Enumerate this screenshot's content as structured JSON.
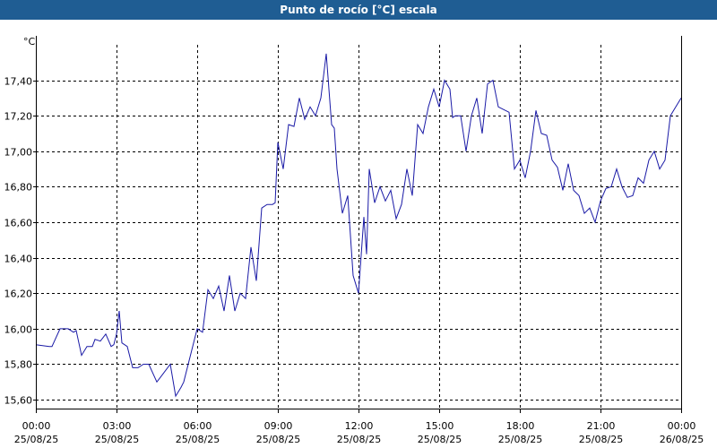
{
  "window": {
    "title": "Punto de rocío [°C] escala"
  },
  "colors": {
    "title_bar": "#1f5d93",
    "line": "#1a1aa6",
    "grid": "#000000"
  },
  "chart_data": {
    "type": "line",
    "title": "Punto de rocío [°C] escala",
    "ylabel": "°C",
    "xlabel": "",
    "ylim": [
      15.55,
      17.6
    ],
    "grid": true,
    "x_unit": "hours",
    "xlim": [
      0,
      24
    ],
    "y_ticks": [
      15.6,
      15.8,
      16.0,
      16.2,
      16.4,
      16.6,
      16.8,
      17.0,
      17.2,
      17.4
    ],
    "y_tick_labels": [
      "15,60",
      "15,80",
      "16,00",
      "16,20",
      "16,40",
      "16,60",
      "16,80",
      "17,00",
      "17,20",
      "17,40"
    ],
    "x_ticks": [
      {
        "t": 0,
        "time": "00:00",
        "date": "25/08/25"
      },
      {
        "t": 3,
        "time": "03:00",
        "date": "25/08/25"
      },
      {
        "t": 6,
        "time": "06:00",
        "date": "25/08/25"
      },
      {
        "t": 9,
        "time": "09:00",
        "date": "25/08/25"
      },
      {
        "t": 12,
        "time": "12:00",
        "date": "25/08/25"
      },
      {
        "t": 15,
        "time": "15:00",
        "date": "25/08/25"
      },
      {
        "t": 18,
        "time": "18:00",
        "date": "25/08/25"
      },
      {
        "t": 21,
        "time": "21:00",
        "date": "25/08/25"
      },
      {
        "t": 24,
        "time": "00:00",
        "date": "26/08/25"
      }
    ],
    "x": [
      0,
      0.5,
      0.6,
      0.9,
      1.2,
      1.4,
      1.5,
      1.7,
      1.9,
      2.1,
      2.2,
      2.4,
      2.6,
      2.8,
      2.9,
      3.0,
      3.1,
      3.2,
      3.4,
      3.6,
      3.8,
      4.0,
      4.2,
      4.5,
      4.7,
      5.0,
      5.2,
      5.4,
      5.5,
      5.8,
      6.0,
      6.2,
      6.4,
      6.6,
      6.8,
      7.0,
      7.2,
      7.4,
      7.6,
      7.8,
      8.0,
      8.2,
      8.4,
      8.6,
      8.8,
      8.9,
      9.0,
      9.2,
      9.4,
      9.6,
      9.8,
      10.0,
      10.2,
      10.4,
      10.6,
      10.8,
      11.0,
      11.1,
      11.2,
      11.4,
      11.6,
      11.8,
      12.0,
      12.2,
      12.3,
      12.4,
      12.6,
      12.8,
      13.0,
      13.2,
      13.4,
      13.6,
      13.8,
      14.0,
      14.2,
      14.4,
      14.6,
      14.8,
      15.0,
      15.2,
      15.4,
      15.5,
      15.6,
      15.8,
      16.0,
      16.2,
      16.4,
      16.6,
      16.8,
      17.0,
      17.2,
      17.6,
      17.8,
      18.0,
      18.2,
      18.4,
      18.6,
      18.8,
      19.0,
      19.2,
      19.4,
      19.6,
      19.8,
      20.0,
      20.2,
      20.4,
      20.6,
      20.8,
      21.0,
      21.2,
      21.4,
      21.6,
      21.8,
      22.0,
      22.2,
      22.4,
      22.6,
      22.8,
      23.0,
      23.2,
      23.4,
      23.6,
      23.8,
      24.0
    ],
    "series": [
      {
        "values": [
          15.91,
          15.9,
          15.9,
          16.0,
          16.0,
          15.98,
          15.99,
          15.85,
          15.9,
          15.9,
          15.94,
          15.93,
          15.97,
          15.9,
          15.91,
          15.97,
          16.1,
          15.92,
          15.9,
          15.78,
          15.78,
          15.8,
          15.8,
          15.7,
          15.74,
          15.8,
          15.62,
          15.67,
          15.7,
          15.88,
          16.0,
          15.98,
          16.22,
          16.17,
          16.24,
          16.1,
          16.3,
          16.1,
          16.2,
          16.17,
          16.46,
          16.27,
          16.68,
          16.7,
          16.7,
          16.71,
          17.05,
          16.9,
          17.15,
          17.14,
          17.3,
          17.18,
          17.25,
          17.2,
          17.3,
          17.55,
          17.15,
          17.13,
          16.9,
          16.65,
          16.75,
          16.3,
          16.2,
          16.63,
          16.42,
          16.9,
          16.71,
          16.8,
          16.72,
          16.78,
          16.62,
          16.7,
          16.9,
          16.75,
          17.15,
          17.1,
          17.25,
          17.35,
          17.25,
          17.4,
          17.35,
          17.19,
          17.2,
          17.2,
          17.0,
          17.2,
          17.3,
          17.1,
          17.38,
          17.4,
          17.25,
          17.22,
          16.9,
          16.95,
          16.85,
          17.0,
          17.23,
          17.1,
          17.09,
          16.95,
          16.91,
          16.78,
          16.93,
          16.78,
          16.75,
          16.65,
          16.68,
          16.6,
          16.72,
          16.79,
          16.8,
          16.9,
          16.8,
          16.74,
          16.75,
          16.85,
          16.82,
          16.95,
          17.0,
          16.9,
          16.95,
          17.2,
          17.25,
          17.3
        ]
      }
    ]
  }
}
